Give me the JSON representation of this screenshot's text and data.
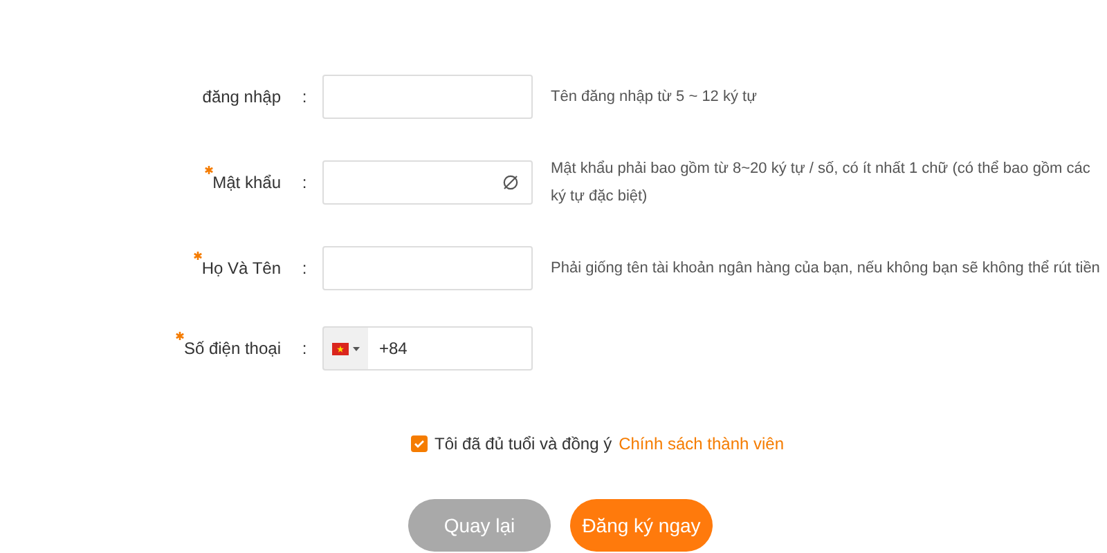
{
  "fields": [
    {
      "label": "đăng nhập",
      "separator": ":",
      "required": false,
      "kind": "text",
      "hint": "Tên đăng nhập từ 5 ~ 12 ký tự"
    },
    {
      "label": "Mật khẩu",
      "separator": ":",
      "required": true,
      "kind": "password",
      "hint": "Mật khẩu phải bao gồm từ 8~20 ký tự / số, có ít nhất 1 chữ (có thể bao gồm các ký tự đặc biệt)"
    },
    {
      "label": "Họ Và Tên",
      "separator": ":",
      "required": true,
      "kind": "text",
      "hint": "Phải giống tên tài khoản ngân hàng của bạn, nếu không bạn sẽ không thể rút tiền"
    },
    {
      "label": "Số điện thoại",
      "separator": ":",
      "required": true,
      "kind": "phone",
      "value": "+84"
    }
  ],
  "agreement": {
    "checked": true,
    "text": "Tôi đã đủ tuổi và đồng ý",
    "link": "Chính sách thành viên"
  },
  "buttons": [
    {
      "label": "Quay lại",
      "kind": "secondary"
    },
    {
      "label": "Đăng ký ngay",
      "kind": "primary"
    }
  ]
}
